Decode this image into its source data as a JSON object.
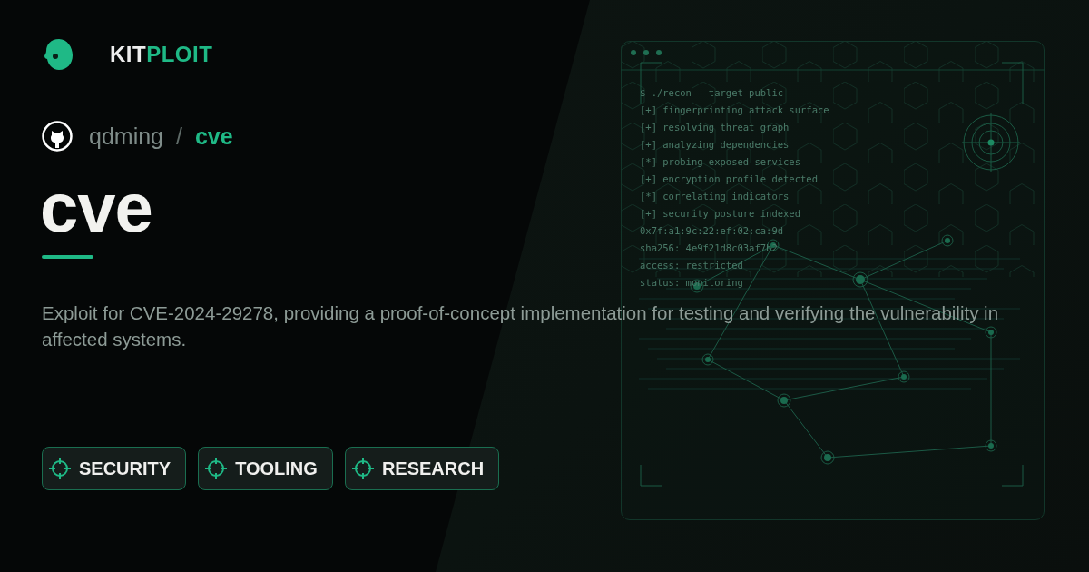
{
  "brand": {
    "name_part_1": "KIT",
    "name_part_2": "PLOIT"
  },
  "repo": {
    "owner": "qdming",
    "separator": "/",
    "name": "cve"
  },
  "title": "cve",
  "description": "Exploit for CVE-2024-29278, providing a proof-of-concept implementation for testing and verifying the vulnerability in affected systems.",
  "tags": [
    "SECURITY",
    "TOOLING",
    "RESEARCH"
  ],
  "terminal": {
    "lines": [
      "$ ./recon --target public",
      "[+] fingerprinting attack surface",
      "[+] resolving threat graph",
      "[+] analyzing dependencies",
      "[*] probing exposed services",
      "[+] encryption profile detected",
      "[*] correlating indicators",
      "[+] security posture indexed",
      "0x7f:a1:9c:22:ef:02:ca:9d",
      "sha256: 4e9f21d8c03af7b2",
      "access: restricted",
      "status: monitoring"
    ]
  }
}
